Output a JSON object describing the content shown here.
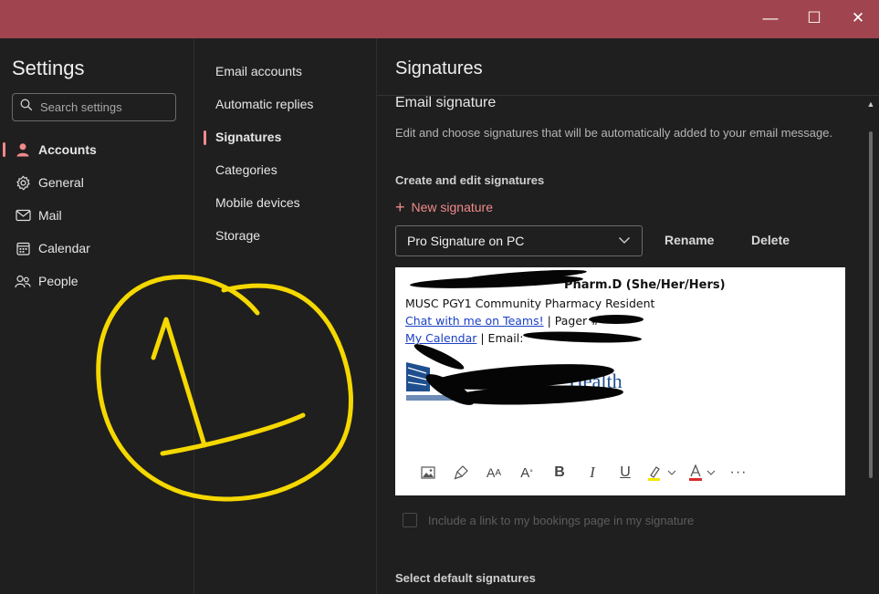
{
  "window": {
    "minimize_glyph": "—",
    "maximize_glyph": "☐",
    "close_glyph": "✕"
  },
  "settings": {
    "title": "Settings",
    "search_placeholder": "Search settings",
    "nav": [
      {
        "label": "Accounts",
        "icon": "person-icon"
      },
      {
        "label": "General",
        "icon": "gear-icon"
      },
      {
        "label": "Mail",
        "icon": "mail-icon"
      },
      {
        "label": "Calendar",
        "icon": "calendar-icon"
      },
      {
        "label": "People",
        "icon": "people-icon"
      }
    ]
  },
  "accounts_menu": {
    "items": [
      "Email accounts",
      "Automatic replies",
      "Signatures",
      "Categories",
      "Mobile devices",
      "Storage"
    ]
  },
  "signatures": {
    "title": "Signatures",
    "section_title": "Email signature",
    "description": "Edit and choose signatures that will be automatically added to your email message.",
    "create_heading": "Create and edit signatures",
    "new_signature_label": "New signature",
    "selected_signature": "Pro Signature on PC",
    "rename_label": "Rename",
    "delete_label": "Delete",
    "signature_content": {
      "line1_visible": "Pharm.D (She/Her/Hers)",
      "line2": "MUSC PGY1 Community Pharmacy Resident",
      "line3_link": "Chat with me on Teams!",
      "line3_rest": "| Pager #",
      "line4_link": "My Calendar",
      "line4_rest": "| Email:",
      "logo_text": "Health"
    },
    "bookings_label": "Include a link to my bookings page in my signature",
    "default_heading": "Select default signatures"
  },
  "colors": {
    "titlebar": "#a0454f",
    "accent": "#f08a8a",
    "background": "#1f1f1f",
    "annotation": "#f5d800",
    "logo_blue": "#1f4f8f"
  }
}
